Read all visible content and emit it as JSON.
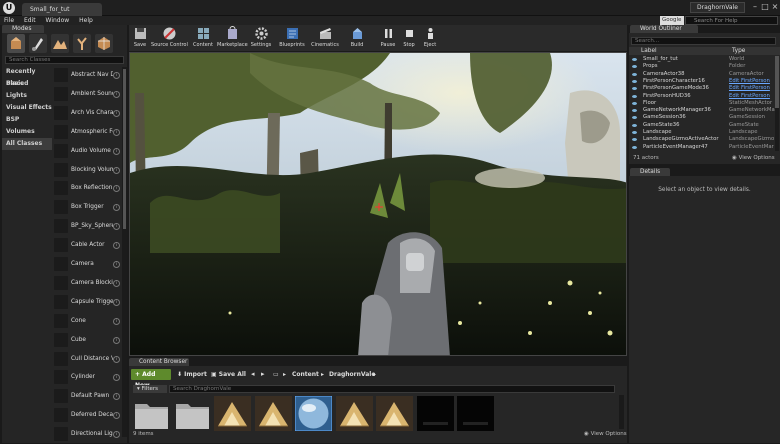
{
  "window": {
    "doc_tab": "Small_for_tut",
    "project_name": "DraghornVale",
    "search_provider": "Google",
    "search_help_placeholder": "Search For Help"
  },
  "menu": [
    "File",
    "Edit",
    "Window",
    "Help"
  ],
  "modes": {
    "tab_label": "Modes",
    "search_placeholder": "Search Classes",
    "categories": [
      "Recently Placed",
      "Basic",
      "Lights",
      "Visual Effects",
      "BSP",
      "Volumes",
      "All Classes"
    ],
    "active_category": "All Classes",
    "items": [
      "Abstract Nav Data",
      "Ambient Sound",
      "Arch Vis Character",
      "Atmospheric Fog",
      "Audio Volume",
      "Blocking Volume",
      "Box Reflection Ca",
      "Box Trigger",
      "BP_Sky_Sphere",
      "Cable Actor",
      "Camera",
      "Camera Blocking",
      "Capsule Trigger",
      "Cone",
      "Cube",
      "Cull Distance Vol",
      "Cylinder",
      "Default Pawn",
      "Deferred Decal",
      "Directional Light"
    ]
  },
  "toolbar": [
    {
      "name": "save",
      "label": "Save",
      "icon": "save-icon"
    },
    {
      "name": "source-control",
      "label": "Source Control",
      "icon": "source-control-icon"
    },
    {
      "name": "content",
      "label": "Content",
      "icon": "content-icon"
    },
    {
      "name": "marketplace",
      "label": "Marketplace",
      "icon": "marketplace-icon"
    },
    {
      "name": "settings",
      "label": "Settings",
      "icon": "gear-icon"
    },
    {
      "name": "blueprints",
      "label": "Blueprints",
      "icon": "blueprint-icon"
    },
    {
      "name": "cinematics",
      "label": "Cinematics",
      "icon": "clapper-icon"
    },
    {
      "name": "build",
      "label": "Build",
      "icon": "build-icon"
    },
    {
      "name": "pause",
      "label": "Pause",
      "icon": "pause-icon"
    },
    {
      "name": "stop",
      "label": "Stop",
      "icon": "stop-icon"
    },
    {
      "name": "eject",
      "label": "Eject",
      "icon": "eject-icon"
    }
  ],
  "content_browser": {
    "tab_label": "Content Browser",
    "add_new": "Add New",
    "import": "Import",
    "save_all": "Save All",
    "path": [
      "Content",
      "DraghornVale"
    ],
    "filters": "Filters",
    "search_placeholder": "Search DraghornVale",
    "count": "9 items",
    "view_options": "View Options",
    "assets": [
      "folder",
      "folder",
      "material",
      "material",
      "sky-sphere",
      "material",
      "material",
      "texture",
      "texture"
    ]
  },
  "world_outliner": {
    "tab_label": "World Outliner",
    "search_placeholder": "Search...",
    "col_label": "Label",
    "col_type": "Type",
    "rows": [
      {
        "label": "Small_for_tut",
        "type": "World",
        "link": false
      },
      {
        "label": "Props",
        "type": "Folder",
        "link": false
      },
      {
        "label": "CameraActor38",
        "type": "CameraActor",
        "link": false
      },
      {
        "label": "FirstPersonCharacter16",
        "type": "Edit FirstPerson",
        "link": true
      },
      {
        "label": "FirstPersonGameMode36",
        "type": "Edit FirstPerson",
        "link": true
      },
      {
        "label": "FirstPersonHUD36",
        "type": "Edit FirstPerson",
        "link": true
      },
      {
        "label": "Floor",
        "type": "StaticMeshActor",
        "link": false
      },
      {
        "label": "GameNetworkManager36",
        "type": "GameNetworkMa",
        "link": false
      },
      {
        "label": "GameSession36",
        "type": "GameSession",
        "link": false
      },
      {
        "label": "GameState36",
        "type": "GameState",
        "link": false
      },
      {
        "label": "Landscape",
        "type": "Landscape",
        "link": false
      },
      {
        "label": "LandscapeGizmoActiveActor",
        "type": "LandscapeGizmo",
        "link": false
      },
      {
        "label": "ParticleEventManager47",
        "type": "ParticleEventMar",
        "link": false
      }
    ],
    "count": "71 actors",
    "view_options": "View Options"
  },
  "details": {
    "tab_label": "Details",
    "message": "Select an object to view details."
  },
  "colors": {
    "accent_green": "#5e8a2c",
    "link_blue": "#6aa8ff",
    "panel_bg": "#262626"
  }
}
